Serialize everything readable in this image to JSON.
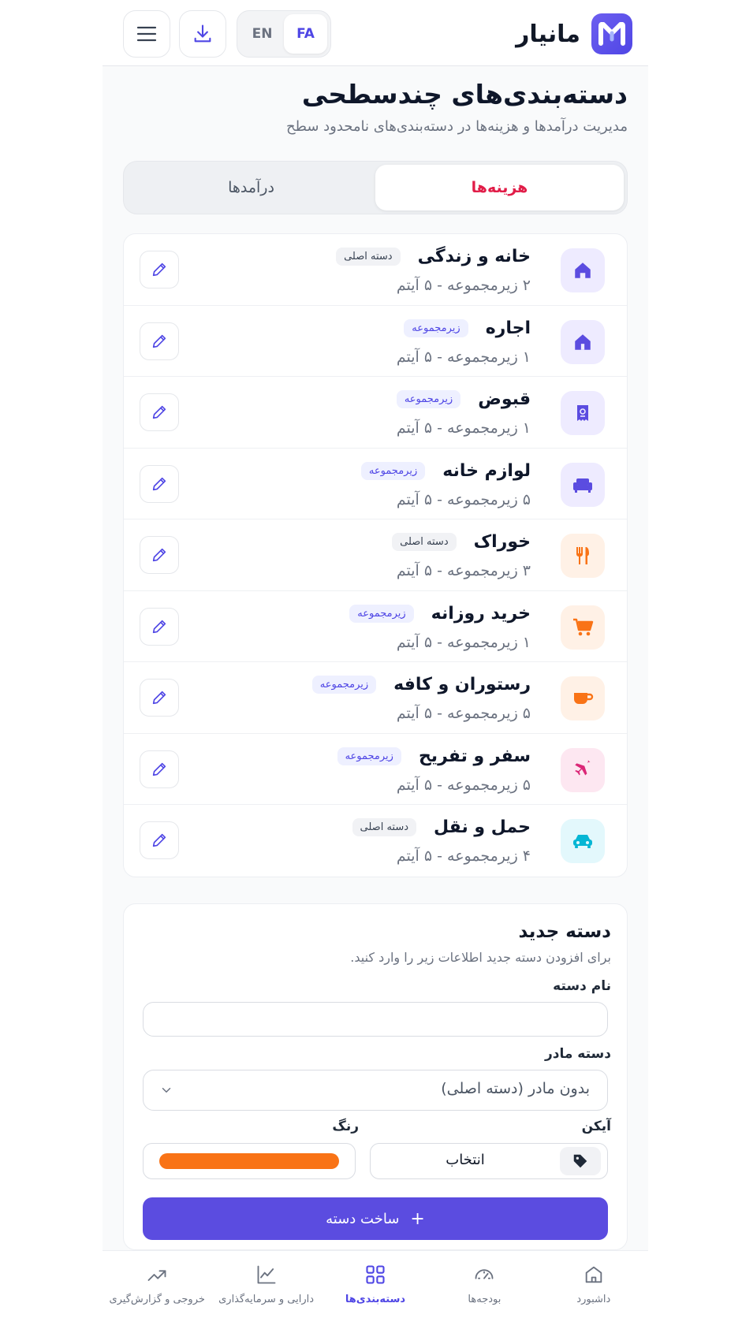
{
  "header": {
    "brand_name": "مانیار",
    "lang_options": [
      "FA",
      "EN"
    ],
    "active_lang": "FA"
  },
  "page": {
    "title": "دسته‌بندی‌های چندسطحی",
    "subtitle": "مدیریت درآمدها و هزینه‌ها در دسته‌بندی‌های نامحدود سطح"
  },
  "tabs": [
    {
      "label": "هزینه‌ها",
      "active": true
    },
    {
      "label": "درآمدها",
      "active": false
    }
  ],
  "categories": [
    {
      "name": "خانه و زندگی",
      "badge": "دسته اصلی",
      "badge_type": "main",
      "meta": "۲ زیرمجموعه - ۵ آیتم",
      "icon": "home-icon",
      "icon_color": "#5b4ce0",
      "icon_bg": "#eeebff"
    },
    {
      "name": "اجاره",
      "badge": "زیرمجموعه",
      "badge_type": "sub",
      "meta": "۱ زیرمجموعه - ۵ آیتم",
      "icon": "house-rent-icon",
      "icon_color": "#5b4ce0",
      "icon_bg": "#eeebff"
    },
    {
      "name": "قبوض",
      "badge": "زیرمجموعه",
      "badge_type": "sub",
      "meta": "۱ زیرمجموعه - ۵ آیتم",
      "icon": "receipt-icon",
      "icon_color": "#5b4ce0",
      "icon_bg": "#eeebff"
    },
    {
      "name": "لوازم خانه",
      "badge": "زیرمجموعه",
      "badge_type": "sub",
      "meta": "۵ زیرمجموعه - ۵ آیتم",
      "icon": "sofa-icon",
      "icon_color": "#5b4ce0",
      "icon_bg": "#eeebff"
    },
    {
      "name": "خوراک",
      "badge": "دسته اصلی",
      "badge_type": "main",
      "meta": "۳ زیرمجموعه - ۵ آیتم",
      "icon": "utensils-icon",
      "icon_color": "#f97316",
      "icon_bg": "#fff1e6"
    },
    {
      "name": "خرید روزانه",
      "badge": "زیرمجموعه",
      "badge_type": "sub",
      "meta": "۱ زیرمجموعه - ۵ آیتم",
      "icon": "cart-icon",
      "icon_color": "#f97316",
      "icon_bg": "#fff1e6"
    },
    {
      "name": "رستوران و کافه",
      "badge": "زیرمجموعه",
      "badge_type": "sub",
      "meta": "۵ زیرمجموعه - ۵ آیتم",
      "icon": "coffee-cup-icon",
      "icon_color": "#f97316",
      "icon_bg": "#fff1e6"
    },
    {
      "name": "سفر و تفریح",
      "badge": "زیرمجموعه",
      "badge_type": "sub",
      "meta": "۵ زیرمجموعه - ۵ آیتم",
      "icon": "airplane-icon",
      "icon_color": "#db2777",
      "icon_bg": "#fde7f1"
    },
    {
      "name": "حمل و نقل",
      "badge": "دسته اصلی",
      "badge_type": "main",
      "meta": "۴ زیرمجموعه - ۵ آیتم",
      "icon": "car-icon",
      "icon_color": "#06b6d4",
      "icon_bg": "#e3f8fc"
    }
  ],
  "form": {
    "title": "دسته جدید",
    "subtitle": "برای افزودن دسته جدید اطلاعات زیر را وارد کنید.",
    "name_label": "نام دسته",
    "name_value": "",
    "parent_label": "دسته مادر",
    "parent_value": "بدون مادر (دسته اصلی)",
    "icon_label": "آیکن",
    "icon_button": "انتخاب",
    "color_label": "رنگ",
    "color_value": "#f97316",
    "submit_label": "ساخت دسته"
  },
  "bottom_nav": [
    {
      "label": "داشبورد",
      "icon": "home-icon",
      "active": false
    },
    {
      "label": "بودجه‌ها",
      "icon": "gauge-icon",
      "active": false
    },
    {
      "label": "دسته‌بندی‌ها",
      "icon": "grid-icon",
      "active": true
    },
    {
      "label": "دارایی و سرمایه‌گذاری",
      "icon": "chart-line-icon",
      "active": false
    },
    {
      "label": "خروجی و گزارش‌گیری",
      "icon": "trending-up-icon",
      "active": false
    }
  ]
}
